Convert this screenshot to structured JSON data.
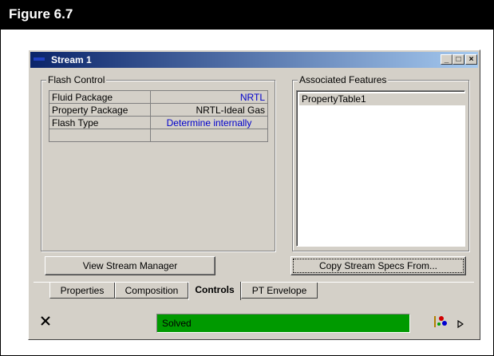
{
  "figure": {
    "title": "Figure 6.7"
  },
  "window": {
    "title": "Stream 1",
    "minimize": "_",
    "maximize": "□",
    "close": "×"
  },
  "flash_control": {
    "label": "Flash Control",
    "rows": [
      {
        "label": "Fluid Package",
        "value": "NRTL"
      },
      {
        "label": "Property Package",
        "value": "NRTL-Ideal Gas"
      },
      {
        "label": "Flash Type",
        "value": "Determine internally"
      },
      {
        "label": "",
        "value": ""
      }
    ]
  },
  "associated_features": {
    "label": "Associated Features",
    "items": [
      "PropertyTable1"
    ]
  },
  "buttons": {
    "view_stream_manager": "View Stream Manager",
    "copy_stream_specs": "Copy Stream Specs From..."
  },
  "tabs": [
    "Properties",
    "Composition",
    "Controls",
    "PT Envelope"
  ],
  "active_tab": "Controls",
  "status": {
    "text": "Solved",
    "color": "#009a00"
  },
  "icons": {
    "delete": "close-x-icon",
    "tools": "object-inspect-icon",
    "arrow": "play-arrow-icon"
  }
}
